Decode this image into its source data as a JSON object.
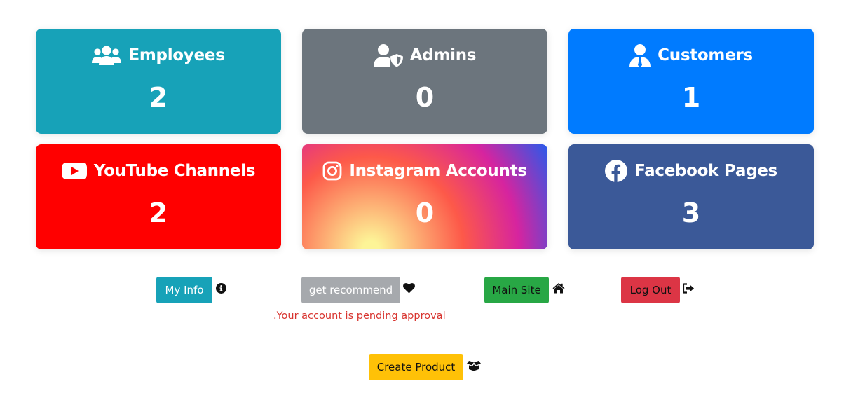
{
  "stats": [
    {
      "label": "Employees",
      "count": "2",
      "icon": "users-icon",
      "color": "#17a2b8"
    },
    {
      "label": "Admins",
      "count": "0",
      "icon": "user-shield-icon",
      "color": "#6c757d"
    },
    {
      "label": "Customers",
      "count": "1",
      "icon": "user-tie-icon",
      "color": "#007bff"
    },
    {
      "label": "YouTube Channels",
      "count": "2",
      "icon": "youtube-icon",
      "color": "#ff0000"
    },
    {
      "label": "Instagram Accounts",
      "count": "0",
      "icon": "instagram-icon",
      "color": "#e1306c"
    },
    {
      "label": "Facebook Pages",
      "count": "3",
      "icon": "facebook-icon",
      "color": "#3b5998"
    }
  ],
  "actions": {
    "my_info": {
      "label": "My Info",
      "icon": "info-circle-icon",
      "color": "#17a2b8"
    },
    "get_recommend": {
      "label": "get recommend",
      "icon": "heart-icon",
      "color": "#a6a9ad"
    },
    "main_site": {
      "label": "Main Site",
      "icon": "home-icon",
      "color": "#28a745"
    },
    "log_out": {
      "label": "Log Out",
      "icon": "sign-out-icon",
      "color": "#dc3545"
    },
    "create_product": {
      "label": "Create Product",
      "icon": "box-open-icon",
      "color": "#ffc107"
    }
  },
  "notice": ".Your account is pending approval"
}
